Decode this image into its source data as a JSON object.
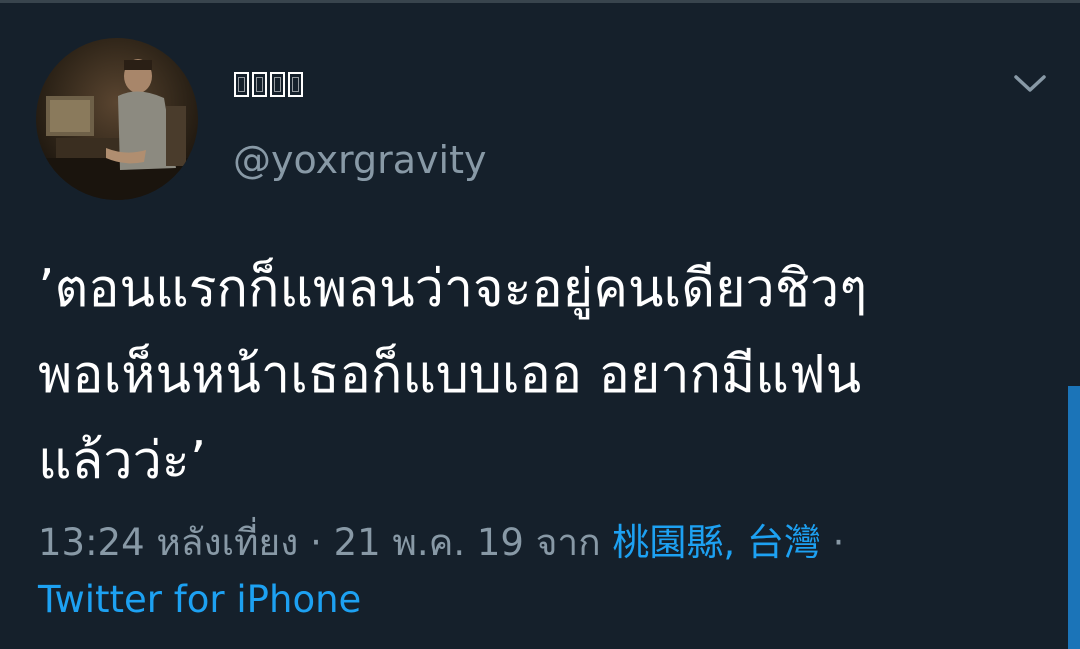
{
  "user": {
    "display_name": "",
    "handle": "@yoxrgravity"
  },
  "tweet": {
    "text": "’ตอนแรกก็แพลนว่าจะอยู่คนเดียวชิวๆ\nพอเห็นหน้าเธอก็แบบเออ อยากมีแฟน\nแล้วว่ะ’",
    "time": "13:24 หลังเที่ยง",
    "separator": "·",
    "date": "21 พ.ค. 19",
    "from_label": "จาก",
    "location": "桃園縣, 台灣",
    "source": "Twitter for iPhone"
  },
  "icons": {
    "caret": "chevron-down-icon",
    "avatar": "avatar-photo"
  },
  "colors": {
    "background": "#15202b",
    "text": "#ffffff",
    "secondary": "#8899a6",
    "link": "#1da1f2"
  }
}
